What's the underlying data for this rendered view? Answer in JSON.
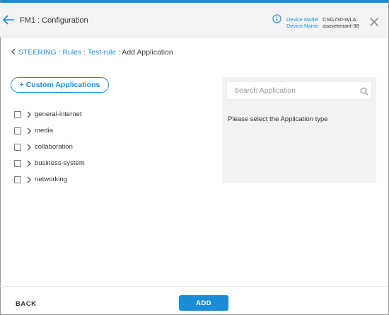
{
  "header": {
    "title": "FM1 : Configuration",
    "device_model_label": "Device Model",
    "device_model_value": "CSG730-WLA",
    "device_name_label": "Device Name",
    "device_name_value": "asasetenant-38",
    "accent_color": "#1a8cd8"
  },
  "breadcrumb": {
    "items": [
      "STEERING",
      "Rules",
      "Test-rule"
    ],
    "separator": " : ",
    "current": "Add Application"
  },
  "custom_apps_button": {
    "label": "+ Custom Applications"
  },
  "tree": {
    "items": [
      {
        "label": "general-internet",
        "checked": false,
        "expanded": false
      },
      {
        "label": "media",
        "checked": false,
        "expanded": false
      },
      {
        "label": "collaboration",
        "checked": false,
        "expanded": false
      },
      {
        "label": "business-system",
        "checked": false,
        "expanded": false
      },
      {
        "label": "networking",
        "checked": false,
        "expanded": false
      }
    ]
  },
  "right_panel": {
    "search_placeholder": "Search Application",
    "message": "Please select the Application type"
  },
  "footer": {
    "back_label": "BACK",
    "add_label": "ADD"
  },
  "icons": {
    "back": "arrow-left-icon",
    "info": "info-circle-icon",
    "close": "close-icon",
    "search": "search-icon",
    "chevron": "chevron-right-icon",
    "breadcrumb_back": "chevron-left-icon"
  }
}
